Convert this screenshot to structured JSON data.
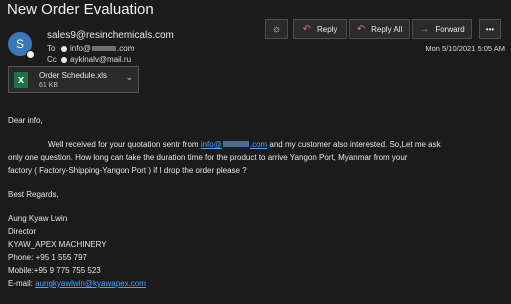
{
  "subject": "New Order Evaluation",
  "sender": {
    "avatar_letter": "S",
    "email": "sales9@resinchemicals.com"
  },
  "recipients": {
    "to_label": "To",
    "to_prefix": "info@",
    "to_suffix": ".com",
    "cc_label": "Cc",
    "cc_value": "aykinalv@mail.ru"
  },
  "toolbar": {
    "reply": "Reply",
    "reply_all": "Reply All",
    "forward": "Forward",
    "more": "•••"
  },
  "date": "Mon 5/10/2021 5:05 AM",
  "attachment": {
    "name": "Order Schedule.xls",
    "size": "61 KB",
    "icon_letter": "X"
  },
  "message": {
    "greeting": "Dear info,",
    "para_line1_start": "Well received for your quotation sentr from ",
    "para_link": "info@",
    "para_link_tail": ".com",
    "para_line1_end": " and my customer also interested. So,Let me ask",
    "para_line2": "only one question. How long can take the duration time for the product to arrive Yangon Port, Myanmar from your",
    "para_line3": "factory ( Factory-Shipping-Yangon Port ) if I drop the order please ?",
    "regards": "Best Regards,",
    "sig_name": "Aung Kyaw Lwin",
    "sig_title": "Director",
    "sig_company": "KYAW_APEX MACHINERY",
    "sig_phone": "Phone: +95 1 555 797",
    "sig_mobile": "Mobile:+95 9 775 755 523",
    "sig_email_label": "E-mail: ",
    "sig_email": "aungkyawlwin@kyawapex.com"
  },
  "colors": {
    "background": "#1b1b1b",
    "link": "#4da3ff",
    "reply_icon": "#d06fb0",
    "forward_icon": "#5aa0e6"
  }
}
